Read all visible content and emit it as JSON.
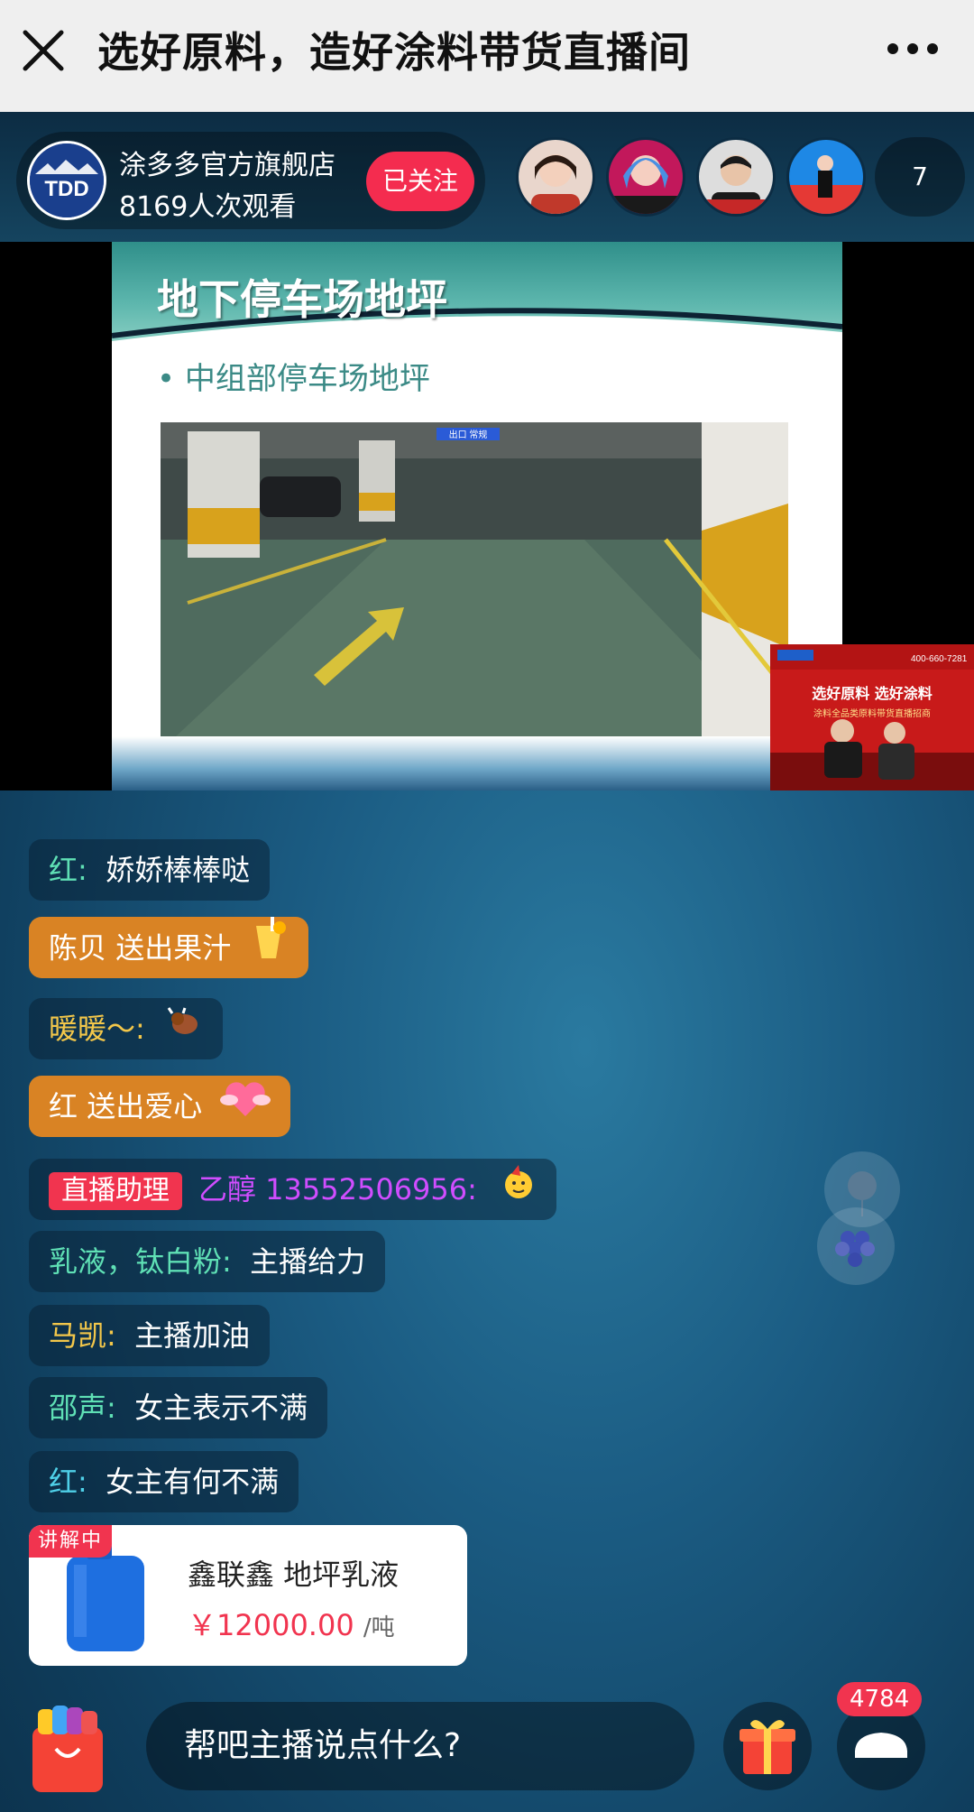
{
  "header": {
    "title": "选好原料，造好涂料带货直播间"
  },
  "anchor": {
    "name": "涂多多官方旗舰店",
    "views": "8169人次观看",
    "follow_label": "已关注",
    "logo_text": "TDD"
  },
  "viewers": {
    "count": "7"
  },
  "slide": {
    "title": "地下停车场地坪",
    "bullet": "• 中组部停车场地坪",
    "sign_text": "出口 常规"
  },
  "pip": {
    "banner_line1": "选好原料 选好涂料",
    "banner_line2": "涂料全品类原料带货直播招商",
    "phone": "400-660-7281"
  },
  "chat": [
    {
      "name": "红:",
      "text": "娇娇棒棒哒"
    },
    {
      "name": "陈贝",
      "text": "送出果汁"
    },
    {
      "name": "暖暖～:",
      "text": ""
    },
    {
      "name": "红",
      "text": "送出爱心"
    },
    {
      "tag": "直播助理",
      "name": "乙醇 13552506956:",
      "text": ""
    },
    {
      "name": "乳液，钛白粉:",
      "text": "主播给力"
    },
    {
      "name": "马凯:",
      "text": "主播加油"
    },
    {
      "name": "邵声:",
      "text": "女主表示不满"
    },
    {
      "name": "红:",
      "text": "女主有何不满"
    }
  ],
  "product": {
    "tag": "讲解中",
    "name": "鑫联鑫 地坪乳液",
    "price": "￥12000.00",
    "unit": "/吨"
  },
  "bottom": {
    "input_placeholder": "帮吧主播说点什么?",
    "like_count": "4784"
  },
  "colors": {
    "accent_red": "#f1344f",
    "gift_orange": "#d98324",
    "bg_blue": "#1b5c83"
  }
}
